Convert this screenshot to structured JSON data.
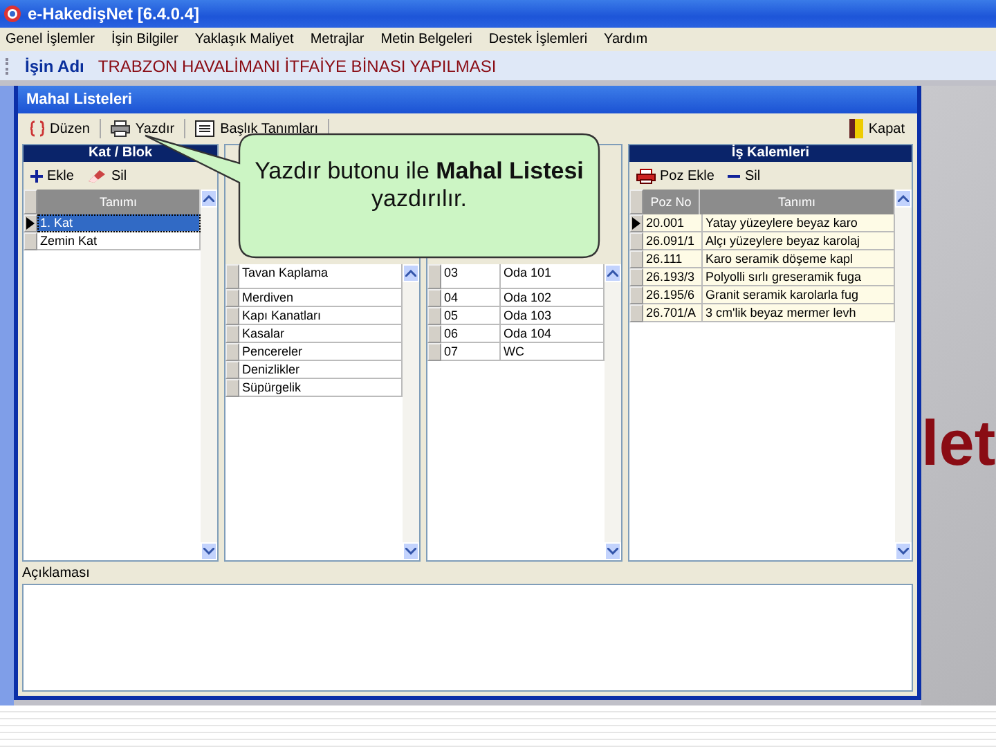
{
  "app": {
    "title": "e-HakedişNet [6.4.0.4]"
  },
  "menu": [
    "Genel İşlemler",
    "İşin Bilgiler",
    "Yaklaşık Maliyet",
    "Metrajlar",
    "Metin Belgeleri",
    "Destek İşlemleri",
    "Yardım"
  ],
  "job": {
    "label": "İşin Adı",
    "value": "TRABZON HAVALİMANI İTFAİYE BİNASI YAPILMASI"
  },
  "window": {
    "title": "Mahal Listeleri",
    "toolbar": [
      {
        "kind": "edit",
        "label": "Düzen"
      },
      {
        "kind": "print",
        "label": "Yazdır"
      },
      {
        "kind": "list",
        "label": "Başlık Tanımları"
      }
    ],
    "close": "Kapat",
    "panels": [
      {
        "kind": "open",
        "title": "Kat / Blok",
        "highlight_selection": true,
        "actions": [
          {
            "kind": "add",
            "label": "Ekle"
          },
          {
            "kind": "delete",
            "label": "Sil"
          }
        ],
        "columns": [
          "Tanımı"
        ],
        "rows": [
          {
            "cells": [
              "1. Kat"
            ],
            "selected": true
          },
          {
            "cells": [
              "Zemin Kat"
            ],
            "selected": false
          }
        ]
      },
      {
        "kind": "covered",
        "rows": [
          {
            "cells": [
              "Tavan Kaplama"
            ],
            "selected": false
          },
          {
            "cells": [
              "Merdiven"
            ],
            "selected": false
          },
          {
            "cells": [
              "Kapı Kanatları"
            ],
            "selected": false
          },
          {
            "cells": [
              "Kasalar"
            ],
            "selected": false
          },
          {
            "cells": [
              "Pencereler"
            ],
            "selected": false
          },
          {
            "cells": [
              "Denizlikler"
            ],
            "selected": false
          },
          {
            "cells": [
              "Süpürgelik"
            ],
            "selected": false
          }
        ]
      },
      {
        "kind": "covered",
        "rows": [
          {
            "cells": [
              "03",
              "Oda 101"
            ],
            "selected": false
          },
          {
            "cells": [
              "04",
              "Oda 102"
            ],
            "selected": false
          },
          {
            "cells": [
              "05",
              "Oda 103"
            ],
            "selected": false
          },
          {
            "cells": [
              "06",
              "Oda 104"
            ],
            "selected": false
          },
          {
            "cells": [
              "07",
              "WC"
            ],
            "selected": false
          }
        ]
      },
      {
        "kind": "open",
        "title": "İş Kalemleri",
        "highlight_selection": false,
        "actions": [
          {
            "kind": "print",
            "label": "Poz Ekle"
          },
          {
            "kind": "remove",
            "label": "Sil"
          }
        ],
        "columns": [
          "Poz No",
          "Tanımı"
        ],
        "rows": [
          {
            "cells": [
              "20.001",
              "Yatay yüzeylere beyaz karo"
            ],
            "selected": true
          },
          {
            "cells": [
              "26.091/1",
              "Alçı yüzeylere beyaz karolaj"
            ],
            "selected": false
          },
          {
            "cells": [
              "26.111",
              "Karo seramik döşeme kapl"
            ],
            "selected": false
          },
          {
            "cells": [
              "26.193/3",
              "Polyolli sırlı greseramik fuga"
            ],
            "selected": false
          },
          {
            "cells": [
              "26.195/6",
              "Granit seramik karolarla fug"
            ],
            "selected": false
          },
          {
            "cells": [
              "26.701/A",
              "3 cm'lik beyaz mermer levh"
            ],
            "selected": false
          }
        ]
      }
    ]
  },
  "notes": {
    "label": "Açıklaması"
  },
  "callout": {
    "text": "Yazdır butonu ile **Mahal Listesi** yazdırılır."
  },
  "background": {
    "text": "let"
  }
}
